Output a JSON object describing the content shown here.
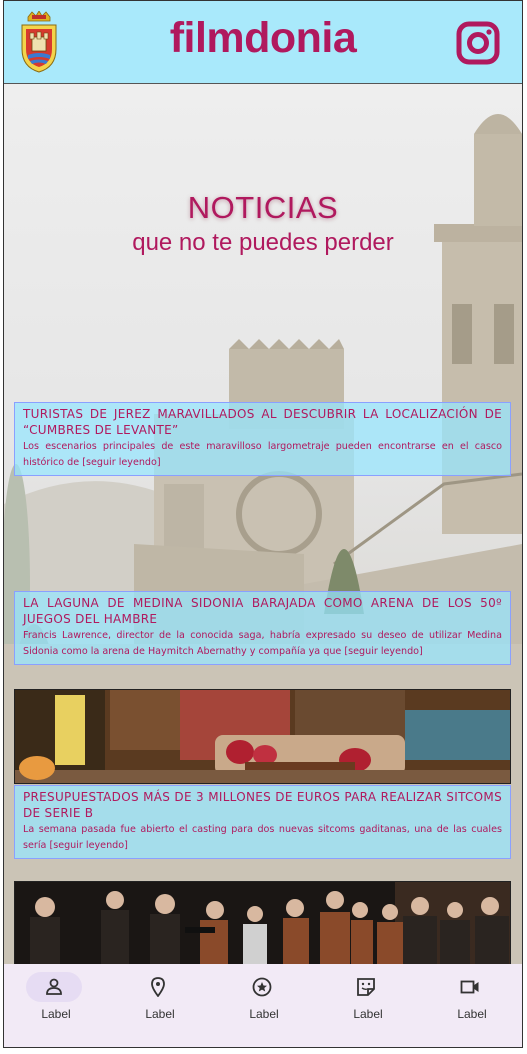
{
  "header": {
    "brand": "filmdonia",
    "crest_icon": "town-crest-icon",
    "social_icon": "instagram-icon",
    "background_color": "#a9e9fb",
    "brand_color": "#b0195e"
  },
  "hero": {
    "title": "NOTICIAS",
    "subtitle": "que no te puedes perder"
  },
  "news": [
    {
      "headline": "TURISTAS DE JEREZ MARAVILLADOS AL DESCUBRIR LA LOCALIZACIÓN DE “CUMBRES DE LEVANTE”",
      "summary": "Los escenarios principales de este maravilloso largometraje pueden encontrarse en el casco histórico de",
      "more": "[seguir leyendo]"
    },
    {
      "headline": "LA LAGUNA DE MEDINA SIDONIA BARAJADA COMO ARENA DE LOS 50º JUEGOS DEL HAMBRE",
      "summary": "Francis Lawrence, director de la conocida saga, habría expresado su deseo de utilizar Medina Sidonia como la arena de Haymitch Abernathy y compañía ya que",
      "more": "[seguir leyendo]"
    },
    {
      "headline": "PRESUPUESTADOS MÁS DE 3 MILLONES DE EUROS PARA REALIZAR SITCOMS DE SERIE B",
      "summary": "La semana pasada fue abierto el casting para dos nuevas sitcoms gaditanas, una de las cuales sería",
      "more": "[seguir leyendo]"
    }
  ],
  "bottom_nav": [
    {
      "label": "Label",
      "icon": "person-icon",
      "active": true
    },
    {
      "label": "Label",
      "icon": "location-pin-icon",
      "active": false
    },
    {
      "label": "Label",
      "icon": "star-circle-icon",
      "active": false
    },
    {
      "label": "Label",
      "icon": "sticker-icon",
      "active": false
    },
    {
      "label": "Label",
      "icon": "videocam-icon",
      "active": false
    }
  ]
}
